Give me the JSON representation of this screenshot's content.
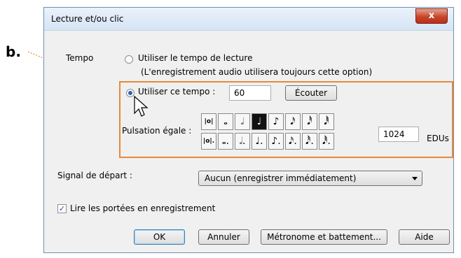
{
  "annotation": {
    "label": "b."
  },
  "window": {
    "title": "Lecture et/ou clic",
    "close_glyph": "x"
  },
  "tempo": {
    "label": "Tempo",
    "option_playback": "Utiliser le tempo de lecture",
    "option_playback_note": "(L'enregistrement audio utilisera toujours cette option)",
    "option_custom": "Utiliser ce tempo :",
    "tempo_value": "60",
    "listen_button": "Écouter",
    "selected_option": "custom"
  },
  "beat": {
    "label": "Pulsation égale :",
    "row1": [
      "|o|",
      "𝅝",
      "𝅗𝅥",
      "♩",
      "♪",
      "𝅘𝅥𝅯",
      "𝅘𝅥𝅰",
      "𝅘𝅥𝅱"
    ],
    "row2": [
      "|o|.",
      "𝅝.",
      "𝅗𝅥.",
      "♩.",
      "♪.",
      "𝅘𝅥𝅯.",
      "𝅘𝅥𝅰.",
      "𝅘𝅥𝅱."
    ],
    "selected_index": 3,
    "edu_value": "1024",
    "edu_unit": "EDUs"
  },
  "start_signal": {
    "label": "Signal de départ :",
    "selected": "Aucun (enregistrer immédiatement)"
  },
  "read_staves": {
    "label": "Lire les portées en enregistrement",
    "checked": true,
    "check_glyph": "✓"
  },
  "buttons": {
    "ok": "OK",
    "cancel": "Annuler",
    "metronome": "Métronome et battement...",
    "help": "Aide"
  },
  "colors": {
    "highlight": "#e8893a",
    "accent": "#2c62b2"
  }
}
